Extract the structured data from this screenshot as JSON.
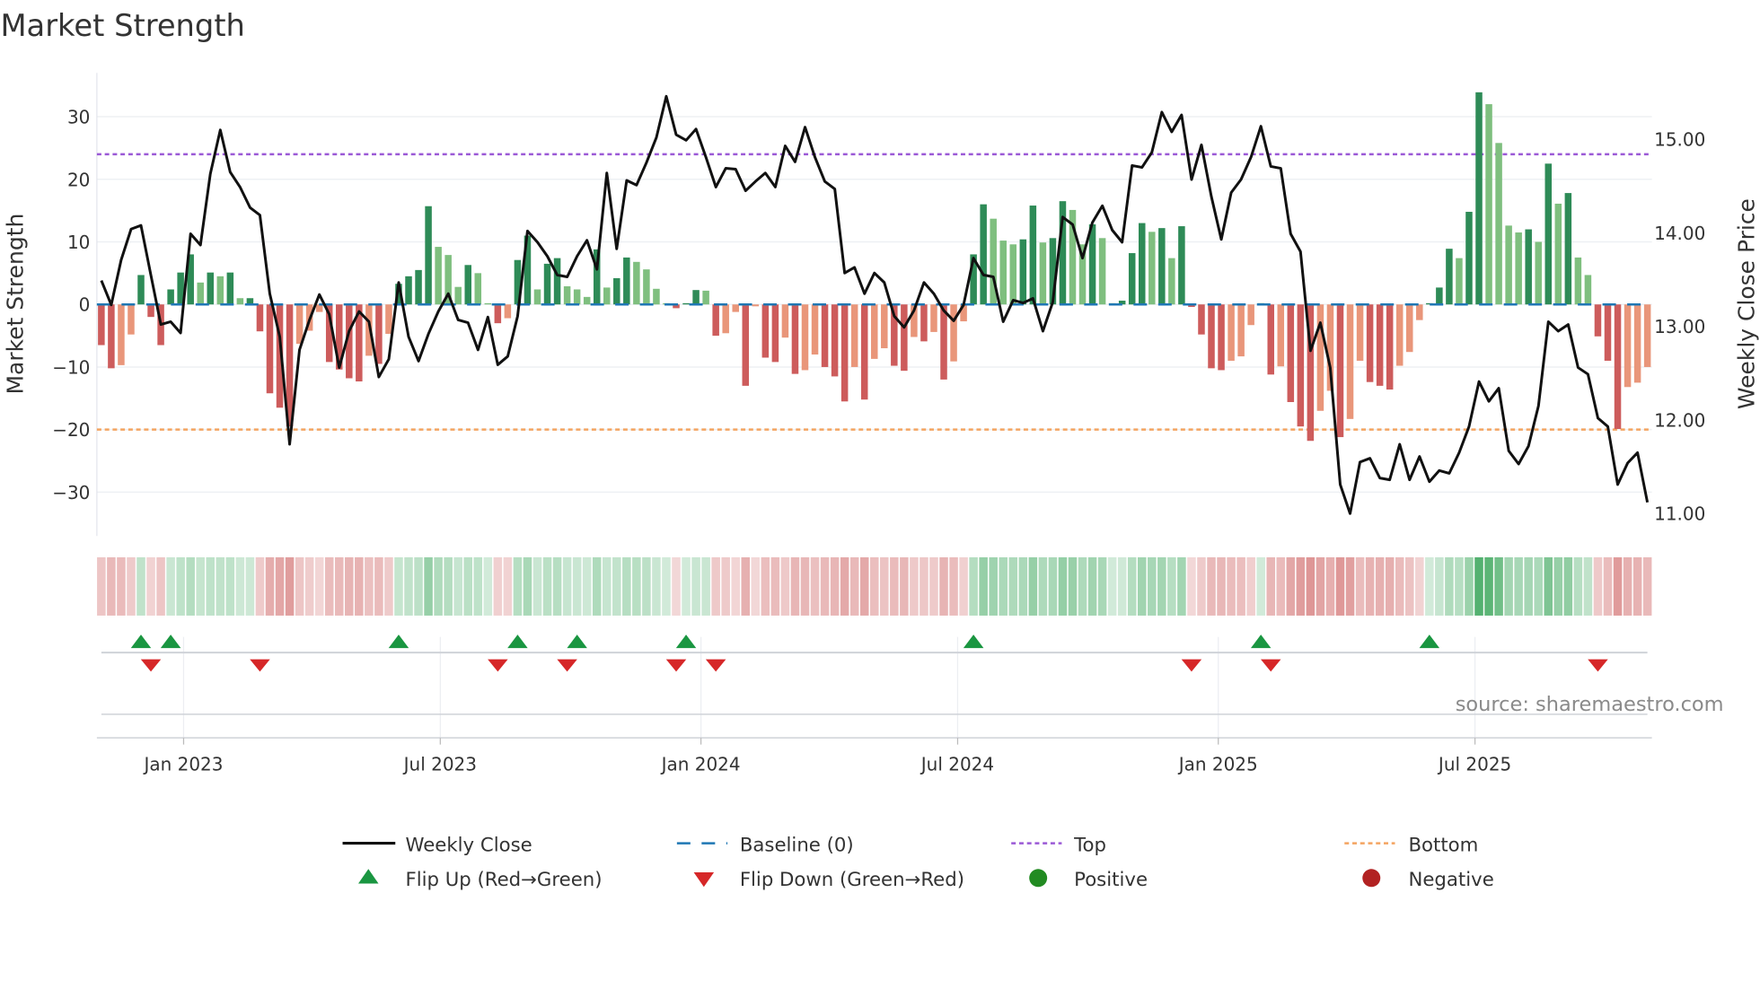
{
  "title": "Market Strength",
  "source": "source: sharemaestro.com",
  "colors": {
    "pos_up": "#2e8b57",
    "pos_down": "#7fbf7f",
    "neg_down": "#cd5c5c",
    "neg_up": "#e9967a",
    "close": "#111111",
    "baseline": "#1f77b4",
    "top": "#9b59d6",
    "bottom": "#f4a460",
    "flip_up": "#1a9641",
    "flip_down": "#d62728",
    "positive": "#228b22",
    "negative": "#b22222"
  },
  "legend": {
    "weekly_close": "Weekly Close",
    "baseline": "Baseline (0)",
    "top": "Top",
    "bottom": "Bottom",
    "flip_up": "Flip Up (Red→Green)",
    "flip_down": "Flip Down (Green→Red)",
    "positive": "Positive",
    "negative": "Negative"
  },
  "chart_data": {
    "type": "bar+line",
    "ylabel": "Market Strength",
    "y2label": "Weekly Close Price",
    "ylim": [
      -37,
      37
    ],
    "y2lim": [
      10.76,
      15.71
    ],
    "xlim": [
      -0.45,
      156.45
    ],
    "yticks": [
      {
        "v": 30,
        "label": "30"
      },
      {
        "v": 20,
        "label": "20"
      },
      {
        "v": 10,
        "label": "10"
      },
      {
        "v": 0,
        "label": "0"
      },
      {
        "v": -10,
        "label": "−10"
      },
      {
        "v": -20,
        "label": "−20"
      },
      {
        "v": -30,
        "label": "−30"
      }
    ],
    "y2ticks": [
      {
        "v": 15,
        "label": "15.00"
      },
      {
        "v": 14,
        "label": "14.00"
      },
      {
        "v": 13,
        "label": "13.00"
      },
      {
        "v": 12,
        "label": "12.00"
      },
      {
        "v": 11,
        "label": "11.00"
      }
    ],
    "xticks": [
      {
        "i": 8.3,
        "label": "Jan 2023"
      },
      {
        "i": 34.2,
        "label": "Jul 2023"
      },
      {
        "i": 60.5,
        "label": "Jan 2024"
      },
      {
        "i": 86.4,
        "label": "Jul 2024"
      },
      {
        "i": 112.7,
        "label": "Jan 2025"
      },
      {
        "i": 138.6,
        "label": "Jul 2025"
      }
    ],
    "top_level": 24,
    "bottom_level": -20,
    "strength": [
      -6.5,
      -10.2,
      -9.7,
      -4.8,
      4.7,
      -2,
      -6.5,
      2.4,
      5.1,
      8,
      3.5,
      5.1,
      4.5,
      5.1,
      1,
      1,
      -4.3,
      -14.2,
      -16.5,
      -19.5,
      -6.3,
      -4.2,
      -1.2,
      -9.2,
      -10.4,
      -11.8,
      -12.3,
      -8.2,
      -9.5,
      -4.7,
      3.3,
      4.5,
      5.5,
      15.7,
      9.2,
      7.9,
      2.8,
      6.3,
      5,
      0.2,
      -3,
      -2.2,
      7.1,
      11,
      2.4,
      6.5,
      7.4,
      2.9,
      2.4,
      1.2,
      8.8,
      2.7,
      4.2,
      7.5,
      6.8,
      5.6,
      2.5,
      0.2,
      -0.6,
      0.2,
      2.3,
      2.2,
      -5,
      -4.6,
      -1.2,
      -13,
      -0.3,
      -8.5,
      -9.2,
      -5.3,
      -11.1,
      -10.5,
      -8,
      -10,
      -11.5,
      -15.5,
      -10,
      -15.2,
      -8.7,
      -7,
      -9.8,
      -10.6,
      -5.2,
      -5.9,
      -4.4,
      -12,
      -9.1,
      -2.7,
      8,
      16,
      13.7,
      10.2,
      9.6,
      10.4,
      15.8,
      9.9,
      10.6,
      16.5,
      15.1,
      9.6,
      12.8,
      10.6,
      0.2,
      0.6,
      8.2,
      13,
      11.6,
      12.2,
      7.4,
      12.5,
      -0.4,
      -4.8,
      -10.2,
      -10.5,
      -9,
      -8.3,
      -3.3,
      0.2,
      -11.2,
      -9.9,
      -15.6,
      -19.5,
      -21.8,
      -17,
      -13.8,
      -21.2,
      -18.3,
      -9,
      -12.4,
      -13,
      -13.6,
      -9.8,
      -7.6,
      -2.5,
      0.2,
      2.7,
      8.9,
      7.4,
      14.8,
      33.9,
      32,
      25.8,
      12.6,
      11.5,
      12,
      10,
      22.5,
      16.1,
      17.8,
      7.5,
      4.7,
      -5.1,
      -9,
      -19.9,
      -13.2,
      -12.5,
      -10
    ],
    "close": [
      13.49,
      13.23,
      13.71,
      14.04,
      14.08,
      13.55,
      13.02,
      13.05,
      12.93,
      13.99,
      13.87,
      14.63,
      15.1,
      14.65,
      14.49,
      14.27,
      14.19,
      13.35,
      12.89,
      11.74,
      12.75,
      13.07,
      13.34,
      13.13,
      12.56,
      12.95,
      13.16,
      13.05,
      12.46,
      12.65,
      13.47,
      12.89,
      12.63,
      12.92,
      13.16,
      13.35,
      13.07,
      13.04,
      12.75,
      13.1,
      12.59,
      12.68,
      13.11,
      14.02,
      13.9,
      13.75,
      13.55,
      13.53,
      13.75,
      13.92,
      13.61,
      14.64,
      13.83,
      14.56,
      14.51,
      14.75,
      15.02,
      15.46,
      15.05,
      14.99,
      15.11,
      14.81,
      14.49,
      14.69,
      14.68,
      14.45,
      14.55,
      14.64,
      14.49,
      14.93,
      14.76,
      15.13,
      14.81,
      14.55,
      14.47,
      13.57,
      13.63,
      13.35,
      13.57,
      13.47,
      13.11,
      12.99,
      13.17,
      13.47,
      13.35,
      13.17,
      13.06,
      13.23,
      13.73,
      13.55,
      13.53,
      13.05,
      13.28,
      13.25,
      13.3,
      12.95,
      13.26,
      14.17,
      14.09,
      13.73,
      14.11,
      14.29,
      14.03,
      13.9,
      14.72,
      14.7,
      14.86,
      15.29,
      15.08,
      15.26,
      14.57,
      14.94,
      14.39,
      13.93,
      14.43,
      14.57,
      14.81,
      15.14,
      14.71,
      14.69,
      13.99,
      13.8,
      12.74,
      13.04,
      12.56,
      11.31,
      11.0,
      11.55,
      11.59,
      11.38,
      11.36,
      11.74,
      11.36,
      11.61,
      11.34,
      11.46,
      11.43,
      11.65,
      11.93,
      12.41,
      12.2,
      12.34,
      11.67,
      11.53,
      11.72,
      12.15,
      13.05,
      12.95,
      13.02,
      12.56,
      12.49,
      12.02,
      11.93,
      11.31,
      11.54,
      11.65,
      11.12
    ],
    "flip_up_idx": [
      4,
      7,
      30,
      42,
      48,
      59,
      88,
      117,
      134
    ],
    "flip_down_idx": [
      5,
      16,
      40,
      47,
      58,
      62,
      110,
      118,
      151
    ],
    "legend_position": "bottom"
  }
}
